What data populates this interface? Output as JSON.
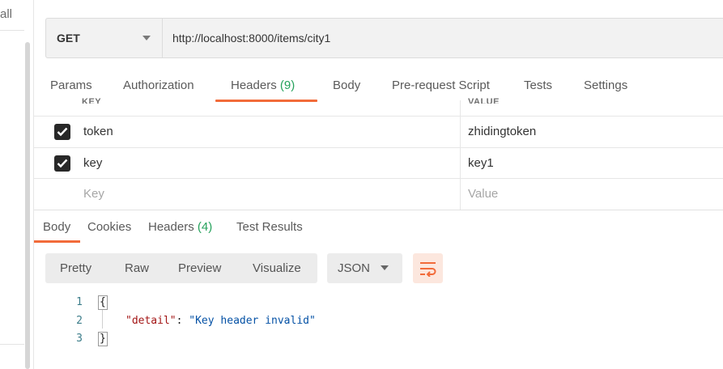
{
  "sidebar": {
    "label": "all"
  },
  "request": {
    "method": "GET",
    "url": "http://localhost:8000/items/city1"
  },
  "request_tabs": [
    {
      "label": "Params"
    },
    {
      "label": "Authorization"
    },
    {
      "label": "Headers",
      "count": "(9)"
    },
    {
      "label": "Body"
    },
    {
      "label": "Pre-request Script"
    },
    {
      "label": "Tests"
    },
    {
      "label": "Settings"
    }
  ],
  "headers_table": {
    "columns": [
      "KEY",
      "VALUE"
    ],
    "rows": [
      {
        "checked": true,
        "key": "token",
        "value": "zhidingtoken"
      },
      {
        "checked": true,
        "key": "key",
        "value": "key1"
      }
    ],
    "placeholder": {
      "key": "Key",
      "value": "Value"
    }
  },
  "response_tabs": [
    {
      "label": "Body"
    },
    {
      "label": "Cookies"
    },
    {
      "label": "Headers",
      "count": "(4)"
    },
    {
      "label": "Test Results"
    }
  ],
  "view_modes": [
    "Pretty",
    "Raw",
    "Preview",
    "Visualize"
  ],
  "format": "JSON",
  "response_body": {
    "line_numbers": [
      "1",
      "2",
      "3"
    ],
    "open_brace": "{",
    "key": "\"detail\"",
    "colon": ": ",
    "value": "\"Key header invalid\"",
    "close_brace": "}"
  },
  "colors": {
    "accent": "#f26b3a",
    "count_green": "#26a25c"
  },
  "icons": {
    "method_caret": "chevron-down-icon",
    "format_caret": "chevron-down-icon",
    "wrap": "wrap-lines-icon",
    "check": "checkmark-icon"
  }
}
